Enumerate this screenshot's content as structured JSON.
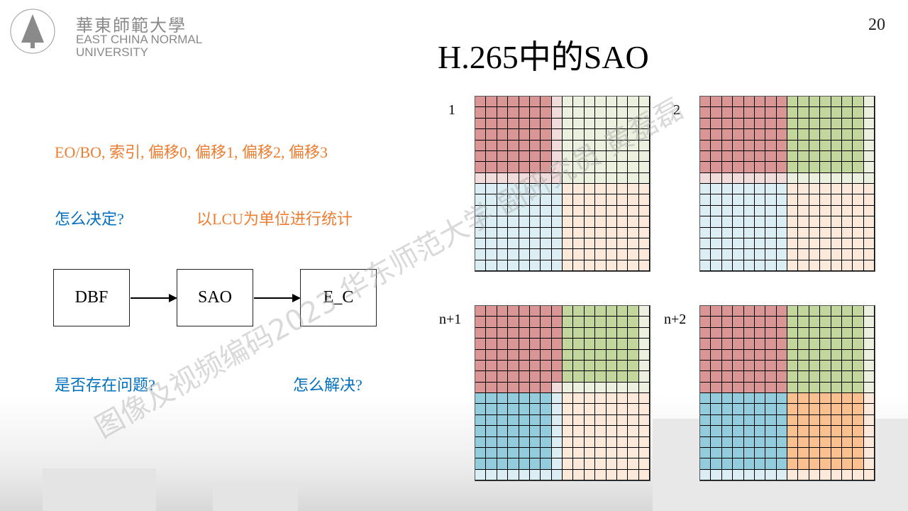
{
  "header": {
    "logo": {
      "cn": "華東師範大學",
      "en_line1": "EAST CHINA NORMAL",
      "en_line2": "UNIVERSITY",
      "seal_text": "EAST CHINA NORMAL UNIVERSITY"
    },
    "page_number": "20",
    "title": "H.265中的SAO"
  },
  "left": {
    "params_text": "EO/BO, 索引, 偏移0, 偏移1, 偏移2, 偏移3",
    "question1": "怎么决定?",
    "answer1": "以LCU为单位进行统计",
    "question2": "是否存在问题?",
    "question3": "怎么解决?",
    "flow": [
      "DBF",
      "SAO",
      "E_C"
    ]
  },
  "colors": {
    "text_orange": "#ed7d31",
    "text_blue": "#0070c0",
    "R": "#d99694",
    "r": "#f2dcdb",
    "G": "#c3d69b",
    "g": "#ebf1de",
    "B": "#93cddd",
    "b": "#dbeef4",
    "O": "#fac090",
    "o": "#fde9d9"
  },
  "grids": [
    {
      "label": "1",
      "rows": [
        "RRRRRRRrgggggggg",
        "RRRRRRRrgggggggg",
        "RRRRRRRrgggggggg",
        "RRRRRRRrgggggggg",
        "RRRRRRRrgggggggg",
        "RRRRRRRrgggggggg",
        "RRRRRRRrgggggggg",
        "rrrrrrrrgggggggg",
        "bbbbbbbboooooooo",
        "bbbbbbbboooooooo",
        "bbbbbbbboooooooo",
        "bbbbbbbboooooooo",
        "bbbbbbbboooooooo",
        "bbbbbbbboooooooo",
        "bbbbbbbboooooooo",
        "bbbbbbbboooooooo"
      ]
    },
    {
      "label": "2",
      "rows": [
        "RRRRRRRRGGGGGGGg",
        "RRRRRRRRGGGGGGGg",
        "RRRRRRRRGGGGGGGg",
        "RRRRRRRRGGGGGGGg",
        "RRRRRRRRGGGGGGGg",
        "RRRRRRRRGGGGGGGg",
        "RRRRRRRRGGGGGGGg",
        "rrrrrrrrgggggggg",
        "bbbbbbbboooooooo",
        "bbbbbbbboooooooo",
        "bbbbbbbboooooooo",
        "bbbbbbbboooooooo",
        "bbbbbbbboooooooo",
        "bbbbbbbboooooooo",
        "bbbbbbbboooooooo",
        "bbbbbbbboooooooo"
      ]
    },
    {
      "label": "n+1",
      "rows": [
        "RRRRRRRRGGGGGGGg",
        "RRRRRRRRGGGGGGGg",
        "RRRRRRRRGGGGGGGg",
        "RRRRRRRRGGGGGGGg",
        "RRRRRRRRGGGGGGGg",
        "RRRRRRRRGGGGGGGg",
        "RRRRRRRRGGGGGGGg",
        "RRRRRRRrgggggggg",
        "BBBBBBBboooooooo",
        "BBBBBBBboooooooo",
        "BBBBBBBboooooooo",
        "BBBBBBBboooooooo",
        "BBBBBBBboooooooo",
        "BBBBBBBboooooooo",
        "BBBBBBBboooooooo",
        "bbbbbbbboooooooo"
      ]
    },
    {
      "label": "n+2",
      "rows": [
        "RRRRRRRRGGGGGGGg",
        "RRRRRRRRGGGGGGGg",
        "RRRRRRRRGGGGGGGg",
        "RRRRRRRRGGGGGGGg",
        "RRRRRRRRGGGGGGGg",
        "RRRRRRRRGGGGGGGg",
        "RRRRRRRRGGGGGGGg",
        "RRRRRRRRGGGGGGGg",
        "BBBBBBBBOOOOOOOo",
        "BBBBBBBBOOOOOOOo",
        "BBBBBBBBOOOOOOOo",
        "BBBBBBBBOOOOOOOo",
        "BBBBBBBBOOOOOOOo",
        "BBBBBBBBOOOOOOOo",
        "BBBBBBBBOOOOOOOo",
        "bbbbbbbboooooooo"
      ]
    }
  ],
  "watermark": "图像及视频编码2023 华东师范大学 副研究员 黄磊磊"
}
